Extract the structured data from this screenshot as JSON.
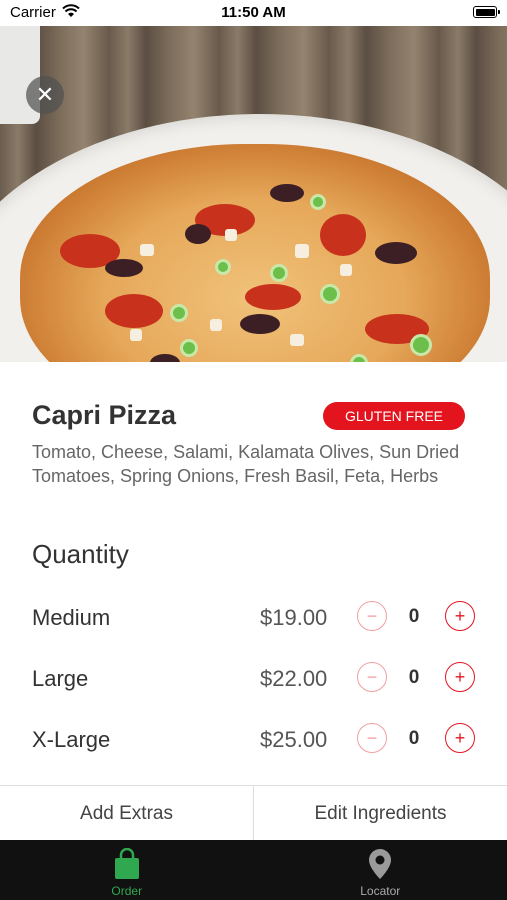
{
  "status_bar": {
    "carrier": "Carrier",
    "time": "11:50 AM"
  },
  "item": {
    "title": "Capri Pizza",
    "badge": "GLUTEN FREE",
    "description": "Tomato, Cheese, Salami, Kalamata Olives, Sun Dried Tomatoes, Spring Onions, Fresh Basil, Feta, Herbs"
  },
  "quantity": {
    "heading": "Quantity",
    "sizes": [
      {
        "name": "Medium",
        "price": "$19.00",
        "count": "0"
      },
      {
        "name": "Large",
        "price": "$22.00",
        "count": "0"
      },
      {
        "name": "X-Large",
        "price": "$25.00",
        "count": "0"
      }
    ]
  },
  "actions": {
    "add_extras": "Add Extras",
    "edit_ingredients": "Edit Ingredients"
  },
  "tabs": [
    {
      "label": "Order",
      "icon": "shopping-bag-icon",
      "active": true
    },
    {
      "label": "Locator",
      "icon": "location-pin-icon",
      "active": false
    }
  ],
  "colors": {
    "accent": "#e4141f",
    "active_tab": "#2fa84f",
    "tab_bar": "#111111"
  }
}
